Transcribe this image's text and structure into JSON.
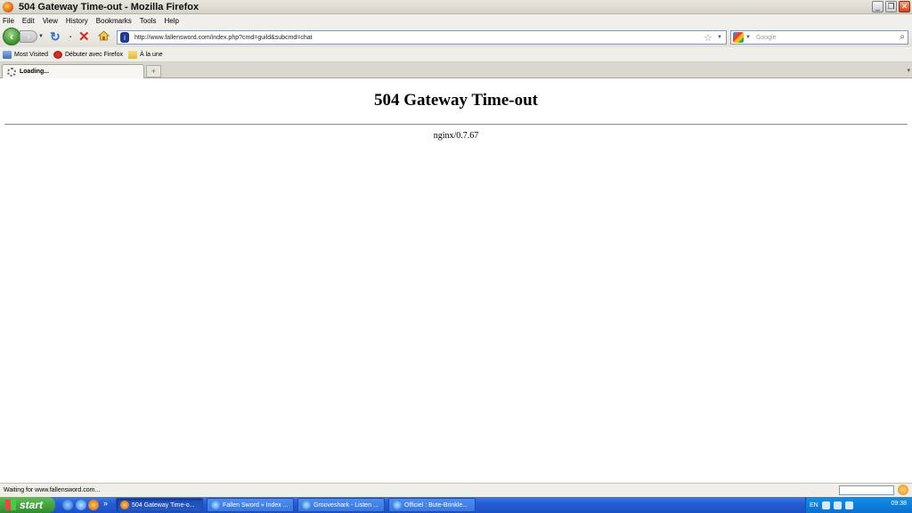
{
  "window": {
    "title": "504 Gateway Time-out - Mozilla Firefox",
    "minimize": "_",
    "restore": "❐",
    "close": "✕"
  },
  "menu": [
    "File",
    "Edit",
    "View",
    "History",
    "Bookmarks",
    "Tools",
    "Help"
  ],
  "navbar": {
    "url": "http://www.fallensword.com/index.php?cmd=guild&subcmd=chat",
    "search_placeholder": "Google"
  },
  "bookmarks": [
    {
      "label": "Most Visited",
      "icon": "bookmark-folder-icon"
    },
    {
      "label": "Débuter avec Firefox",
      "icon": "firefox-bookmark-icon"
    },
    {
      "label": "À la une",
      "icon": "rss-folder-icon"
    }
  ],
  "tabs": [
    {
      "label": "Loading..."
    }
  ],
  "content": {
    "heading": "504 Gateway Time-out",
    "server": "nginx/0.7.67"
  },
  "status": {
    "text": "Waiting for www.fallensword.com..."
  },
  "taskbar": {
    "start_label": "start",
    "tasks": [
      {
        "label": "504 Gateway Time-o...",
        "icon": "firefox-icon",
        "active": true
      },
      {
        "label": "Fallen Sword » Index ...",
        "icon": "ie-icon",
        "active": false
      },
      {
        "label": "Grooveshark - Listen ...",
        "icon": "ie-icon",
        "active": false
      },
      {
        "label": "Officiel : Bute-Brinkle...",
        "icon": "ie-icon",
        "active": false
      }
    ],
    "tray": {
      "language": "EN",
      "clock": "09:38"
    }
  }
}
